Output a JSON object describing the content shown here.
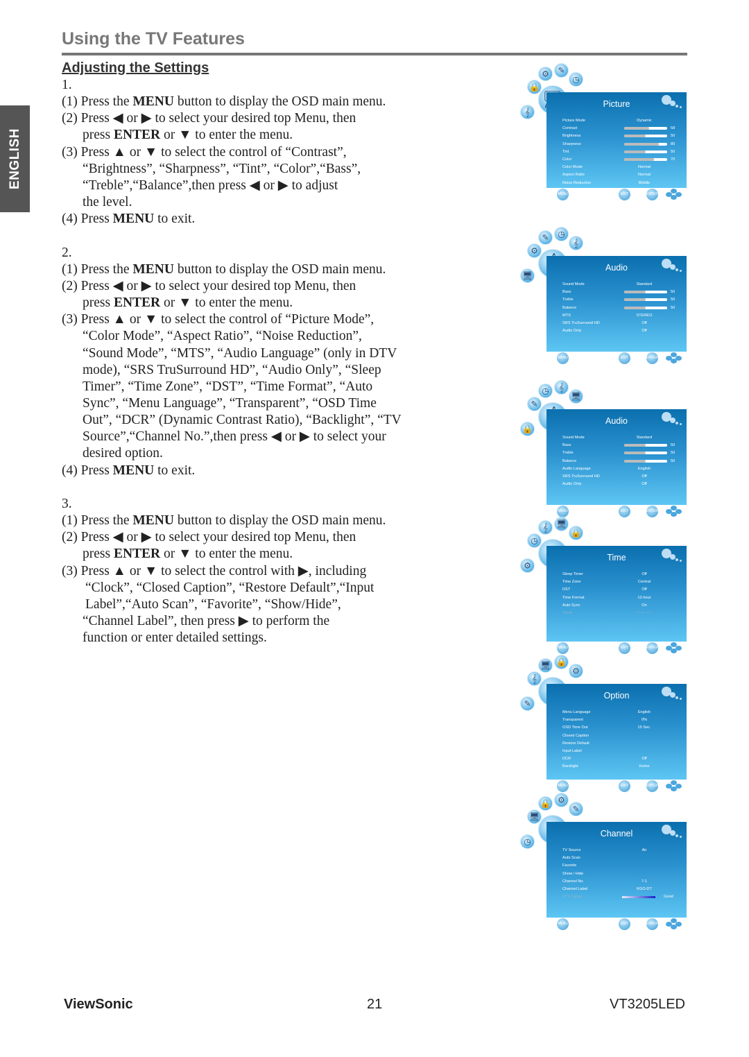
{
  "header": {
    "title": "Using the TV Features",
    "subtitle": "Adjusting the Settings"
  },
  "side_tab": {
    "label": "ENGLISH",
    "color": "#555555"
  },
  "bold_terms": [
    "MENU",
    "ENTER"
  ],
  "body_lines": [
    {
      "text": "1.",
      "indent": 0
    },
    {
      "text": "(1) Press the MENU button to display the OSD main menu.",
      "indent": 0
    },
    {
      "text": "(2) Press ◀ or ▶ to select your desired top Menu, then",
      "indent": 0
    },
    {
      "text": "press ENTER or ▼ to enter the menu.",
      "indent": 30
    },
    {
      "text": "(3) Press ▲ or ▼ to select the control of “Contrast”,",
      "indent": 0
    },
    {
      "text": "“Brightness”, “Sharpness”, “Tint”, “Color”,“Bass”,",
      "indent": 30
    },
    {
      "text": "“Treble”,“Balance”,then press ◀ or ▶ to adjust",
      "indent": 30
    },
    {
      "text": "the level.",
      "indent": 30
    },
    {
      "text": "(4) Press MENU to exit.",
      "indent": 0
    },
    {
      "text": "",
      "indent": 0
    },
    {
      "text": "2.",
      "indent": 0
    },
    {
      "text": "(1) Press the MENU button to display the OSD main menu.",
      "indent": 0
    },
    {
      "text": "(2) Press ◀ or ▶ to select your desired top Menu, then",
      "indent": 0
    },
    {
      "text": "press ENTER or ▼ to enter the menu.",
      "indent": 30
    },
    {
      "text": "(3) Press ▲ or ▼ to select the control of “Picture Mode”,",
      "indent": 0
    },
    {
      "text": "“Color Mode”, “Aspect Ratio”, “Noise Reduction”,",
      "indent": 30
    },
    {
      "text": "“Sound Mode”,  “MTS”,  “Audio Language” (only in DTV",
      "indent": 30
    },
    {
      "text": "mode), “SRS TruSurround HD”, “Audio Only”, “Sleep",
      "indent": 30
    },
    {
      "text": "Timer”, “Time Zone”, “DST”, “Time Format”, “Auto",
      "indent": 30
    },
    {
      "text": "Sync”, “Menu Language”, “Transparent”, “OSD Time",
      "indent": 30
    },
    {
      "text": "Out”,  “DCR” (Dynamic Contrast Ratio), “Backlight”, “TV",
      "indent": 30
    },
    {
      "text": "Source”,“Channel No.”,then press ◀ or ▶ to select your",
      "indent": 30
    },
    {
      "text": "desired option.",
      "indent": 30
    },
    {
      "text": "(4) Press MENU to exit.",
      "indent": 0
    },
    {
      "text": "",
      "indent": 0
    },
    {
      "text": "3.",
      "indent": 0
    },
    {
      "text": "(1) Press the MENU button to display the OSD main menu.",
      "indent": 0
    },
    {
      "text": "(2) Press ◀ or ▶ to select your desired top Menu, then",
      "indent": 0
    },
    {
      "text": "press ENTER or ▼ to enter the menu.",
      "indent": 30
    },
    {
      "text": "(3) Press ▲ or ▼ to select the control with ▶, including",
      "indent": 0
    },
    {
      "text": "“Clock”, “Closed Caption”, “Restore Default”,“Input",
      "indent": 34
    },
    {
      "text": "Label”,“Auto Scan”, “Favorite”, “Show/Hide”,",
      "indent": 34
    },
    {
      "text": "“Channel Label”,   then press ▶ to perform the",
      "indent": 30
    },
    {
      "text": "function or enter detailed settings.",
      "indent": 30
    }
  ],
  "osd_menus": [
    {
      "title": "Picture",
      "icon": "picture-icon",
      "rows": [
        {
          "label": "Picture Mode",
          "value": "Dynamic"
        },
        {
          "label": "Contrast",
          "bar": 58,
          "value": "58"
        },
        {
          "label": "Brightness",
          "bar": 50,
          "value": "50"
        },
        {
          "label": "Sharpness",
          "bar": 80,
          "value": "80"
        },
        {
          "label": "Tint",
          "bar": 50,
          "value": "50"
        },
        {
          "label": "Color",
          "bar": 70,
          "value": "70"
        },
        {
          "label": "Color Mode",
          "value": "Normal"
        },
        {
          "label": "Aspect Ratio",
          "value": "Normal"
        },
        {
          "label": "Noise Reduction",
          "value": "Middle"
        }
      ]
    },
    {
      "title": "Audio",
      "icon": "audio-icon",
      "rows": [
        {
          "label": "Sound Mode",
          "value": "Standard"
        },
        {
          "label": "Bass",
          "bar": 50,
          "value": "50"
        },
        {
          "label": "Treble",
          "bar": 50,
          "value": "50"
        },
        {
          "label": "Balance",
          "bar": 50,
          "value": "50"
        },
        {
          "label": "MTS",
          "value": "STEREO"
        },
        {
          "label": "SRS TruSurround HD",
          "value": "Off"
        },
        {
          "label": "Audio Only",
          "value": "Off"
        }
      ]
    },
    {
      "title": "Audio",
      "icon": "audio-icon",
      "rows": [
        {
          "label": "Sound Mode",
          "value": "Standard"
        },
        {
          "label": "Bass",
          "bar": 50,
          "value": "50"
        },
        {
          "label": "Treble",
          "bar": 50,
          "value": "50"
        },
        {
          "label": "Balance",
          "bar": 50,
          "value": "50"
        },
        {
          "label": "Audio Language",
          "value": "English"
        },
        {
          "label": "SRS TruSurround HD",
          "value": "Off"
        },
        {
          "label": "Audio Only",
          "value": "Off"
        }
      ]
    },
    {
      "title": "Time",
      "icon": "time-icon",
      "rows": [
        {
          "label": "Sleep Timer",
          "value": "Off"
        },
        {
          "label": "Time Zone",
          "value": "Central"
        },
        {
          "label": "DST",
          "value": "Off"
        },
        {
          "label": "Time Format",
          "value": "12-hour"
        },
        {
          "label": "Auto Sync",
          "value": "On"
        },
        {
          "label": "Clock",
          "value": "--/--/-- --:--",
          "disabled": true
        }
      ]
    },
    {
      "title": "Option",
      "icon": "option-icon",
      "rows": [
        {
          "label": "Menu Language",
          "value": "English"
        },
        {
          "label": "Transparent",
          "value": "0%"
        },
        {
          "label": "OSD Time Out",
          "value": "15 Sec."
        },
        {
          "label": "Closed Caption",
          "value": ""
        },
        {
          "label": "Restore Default",
          "value": ""
        },
        {
          "label": "Input Label",
          "value": ""
        },
        {
          "label": "DCR",
          "value": "Off"
        },
        {
          "label": "Backlight",
          "value": "Home"
        }
      ]
    },
    {
      "title": "Channel",
      "icon": "channel-icon",
      "rows": [
        {
          "label": "TV Source",
          "value": "Air"
        },
        {
          "label": "Auto Scan",
          "value": ""
        },
        {
          "label": "Favorite",
          "value": ""
        },
        {
          "label": "Show / Hide",
          "value": ""
        },
        {
          "label": "Channel No.",
          "value": "7-1"
        },
        {
          "label": "Channel Label",
          "value": "KGO-DT"
        },
        {
          "label": "DTV Signal",
          "signal": true,
          "value": "Good",
          "disabled": true
        }
      ]
    }
  ],
  "osd_buttons": {
    "menu": "MENU",
    "exit": "EXIT",
    "enter": "ENTER"
  },
  "footer": {
    "brand": "ViewSonic",
    "page": "21",
    "model": "VT3205LED"
  }
}
